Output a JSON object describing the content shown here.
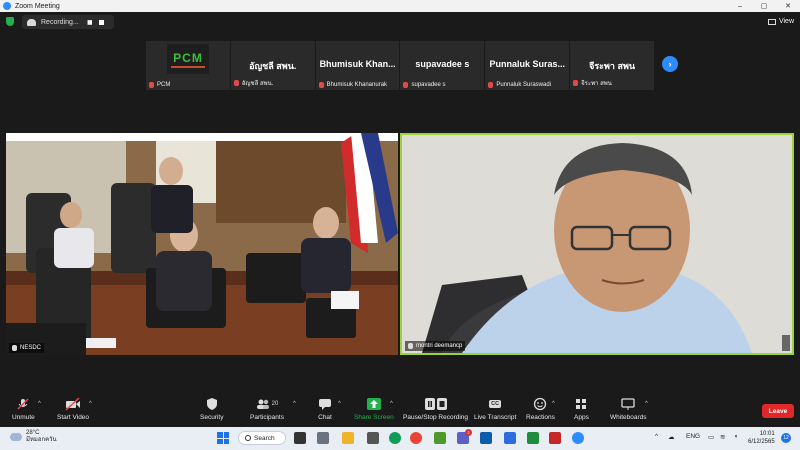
{
  "window": {
    "title": "Zoom Meeting",
    "controls": [
      "–",
      "▢",
      "✕"
    ]
  },
  "recording": {
    "label": "Recording...",
    "pause": "▮▮"
  },
  "view": {
    "label": "View"
  },
  "thumbnails": [
    {
      "display": "",
      "label": "PCM",
      "logo": "PCM"
    },
    {
      "display": "อัญชลี สพน.",
      "label": "อัญชลี สพน."
    },
    {
      "display": "Bhumisuk  Khan...",
      "label": "Bhumisuk Khananurak"
    },
    {
      "display": "supavadee s",
      "label": "supavadee s"
    },
    {
      "display": "Punnaluk Suras...",
      "label": "Punnaluk Suraswadi"
    },
    {
      "display": "จีระพา สพน",
      "label": "จีระพา สพน"
    }
  ],
  "next_button": "›",
  "videos": {
    "left": {
      "label": "NESDC"
    },
    "right": {
      "label": "montri deemancp"
    }
  },
  "toolbar": {
    "unmute": "Unmute",
    "start_video": "Start Video",
    "security": "Security",
    "participants": "Participants",
    "participants_count": "20",
    "chat": "Chat",
    "share_screen": "Share Screen",
    "pause_stop_recording": "Pause/Stop Recording",
    "live_transcript": "Live Transcript",
    "cc": "CC",
    "reactions": "Reactions",
    "apps": "Apps",
    "whiteboards": "Whiteboards",
    "leave": "Leave"
  },
  "taskbar": {
    "temperature": "28°C",
    "weather_desc": "มีหมอกควัน",
    "search": "Search",
    "language": "ENG",
    "time": "10:01",
    "date": "6/12/2565",
    "notifications": "12",
    "teams_badge": "2"
  },
  "colors": {
    "zoom_blue": "#2d8cff",
    "active_speaker": "#9bd33a",
    "share_green": "#21b04b",
    "leave_red": "#e02828",
    "muted_red": "#e54848"
  }
}
